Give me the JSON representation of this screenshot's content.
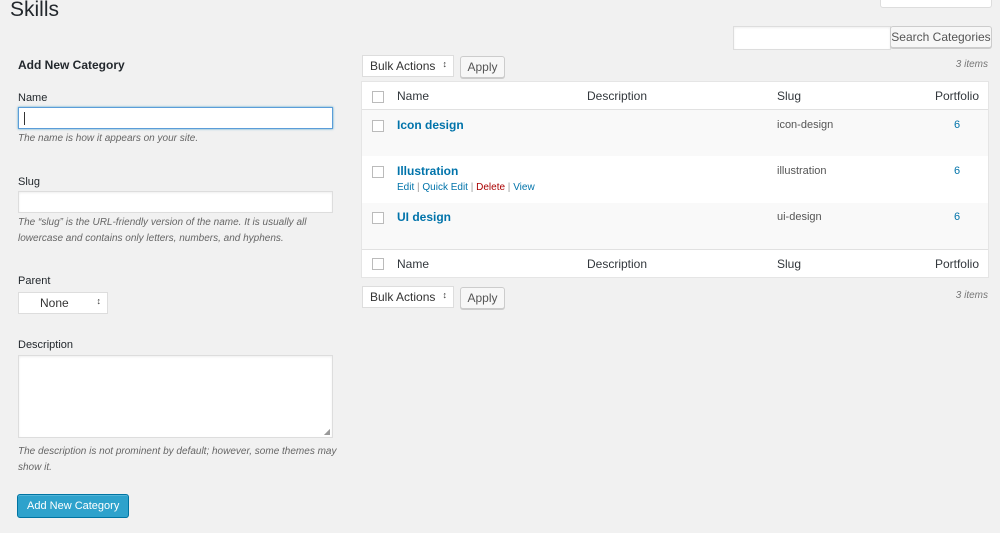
{
  "page": {
    "title": "Skills"
  },
  "search": {
    "placeholder": "",
    "button_label": "Search Categories"
  },
  "form": {
    "title": "Add New Category",
    "name": {
      "label": "Name",
      "hint": "The name is how it appears on your site."
    },
    "slug": {
      "label": "Slug",
      "hint": "The “slug” is the URL-friendly version of the name. It is usually all lowercase and contains only letters, numbers, and hyphens."
    },
    "parent": {
      "label": "Parent",
      "selected": "None"
    },
    "description": {
      "label": "Description",
      "hint": "The description is not prominent by default; however, some themes may show it."
    },
    "submit_label": "Add New Category"
  },
  "toolbar_top": {
    "bulk_label": "Bulk Actions",
    "apply_label": "Apply",
    "count": "3 items"
  },
  "toolbar_bottom": {
    "bulk_label": "Bulk Actions",
    "apply_label": "Apply",
    "count": "3 items"
  },
  "table": {
    "columns": [
      "Name",
      "Description",
      "Slug",
      "Portfolio"
    ],
    "rows": [
      {
        "name": "Icon design",
        "description": "",
        "slug": "icon-design",
        "count": "6"
      },
      {
        "name": "Illustration",
        "description": "",
        "slug": "illustration",
        "count": "6",
        "actions": [
          "Edit",
          "Quick Edit",
          "Delete",
          "View"
        ]
      },
      {
        "name": "UI design",
        "description": "",
        "slug": "ui-design",
        "count": "6"
      }
    ]
  },
  "colors": {
    "link": "#0073aa",
    "primary": "#2ea2cc",
    "delete": "#aa0000",
    "background": "#f1f1f1"
  },
  "icons": {
    "select_arrows": "↕"
  }
}
